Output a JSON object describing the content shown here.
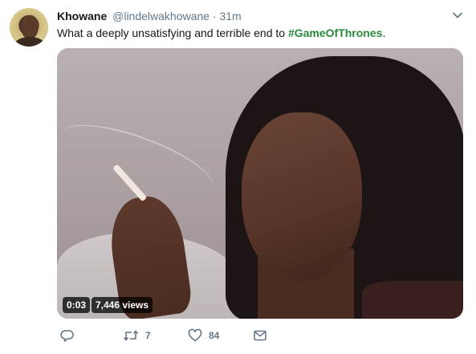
{
  "tweet": {
    "author_name": "Khowane",
    "author_handle": "@lindelwakhowane",
    "separator": "·",
    "time": "31m",
    "text_prefix": "What a deeply unsatisfying and terrible end to ",
    "hashtag": "#GameOfThrones",
    "text_suffix": "."
  },
  "media": {
    "duration": "0:03",
    "views": "7,446 views"
  },
  "actions": {
    "retweet_count": "7",
    "like_count": "84"
  },
  "colors": {
    "hashtag": "#2a8a3b",
    "muted": "#657786",
    "text": "#14171a"
  },
  "icons": [
    "chevron-down-icon",
    "reply-icon",
    "retweet-icon",
    "heart-icon",
    "envelope-icon"
  ]
}
